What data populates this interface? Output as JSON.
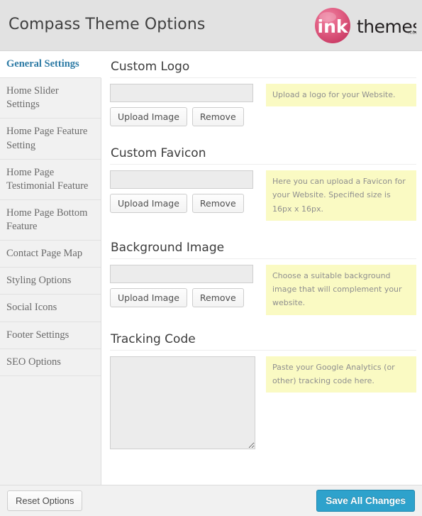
{
  "header": {
    "title": "Compass Theme Options",
    "logo": {
      "mark_text": "ink",
      "word_text": "themes",
      "tld_text": ".com",
      "circle_color": "#d94f76",
      "word_color": "#231f20"
    }
  },
  "sidebar": {
    "items": [
      {
        "label": "General Settings",
        "active": true
      },
      {
        "label": "Home Slider Settings",
        "active": false
      },
      {
        "label": "Home Page Feature Setting",
        "active": false
      },
      {
        "label": "Home Page Testimonial Feature",
        "active": false
      },
      {
        "label": "Home Page Bottom Feature",
        "active": false
      },
      {
        "label": "Contact Page Map",
        "active": false
      },
      {
        "label": "Styling Options",
        "active": false
      },
      {
        "label": "Social Icons",
        "active": false
      },
      {
        "label": "Footer Settings",
        "active": false
      },
      {
        "label": "SEO Options",
        "active": false
      }
    ],
    "active_color": "#2e7ba5"
  },
  "main": {
    "sections": [
      {
        "title": "Custom Logo",
        "input_value": "",
        "input_placeholder": "",
        "upload_label": "Upload Image",
        "remove_label": "Remove",
        "hint": "Upload a logo for your Website."
      },
      {
        "title": "Custom Favicon",
        "input_value": "",
        "input_placeholder": "",
        "upload_label": "Upload Image",
        "remove_label": "Remove",
        "hint": "Here you can upload a Favicon for your Website. Specified size is 16px x 16px."
      },
      {
        "title": "Background Image",
        "input_value": "",
        "input_placeholder": "",
        "upload_label": "Upload Image",
        "remove_label": "Remove",
        "hint": "Choose a suitable background image that will complement your website."
      }
    ],
    "tracking": {
      "title": "Tracking Code",
      "textarea_value": "",
      "textarea_placeholder": "",
      "hint": "Paste your Google Analytics (or other) tracking code here."
    },
    "hint_bg_color": "#fafac3"
  },
  "footer": {
    "reset_label": "Reset Options",
    "save_label": "Save All Changes",
    "save_color": "#2ea2cc"
  }
}
